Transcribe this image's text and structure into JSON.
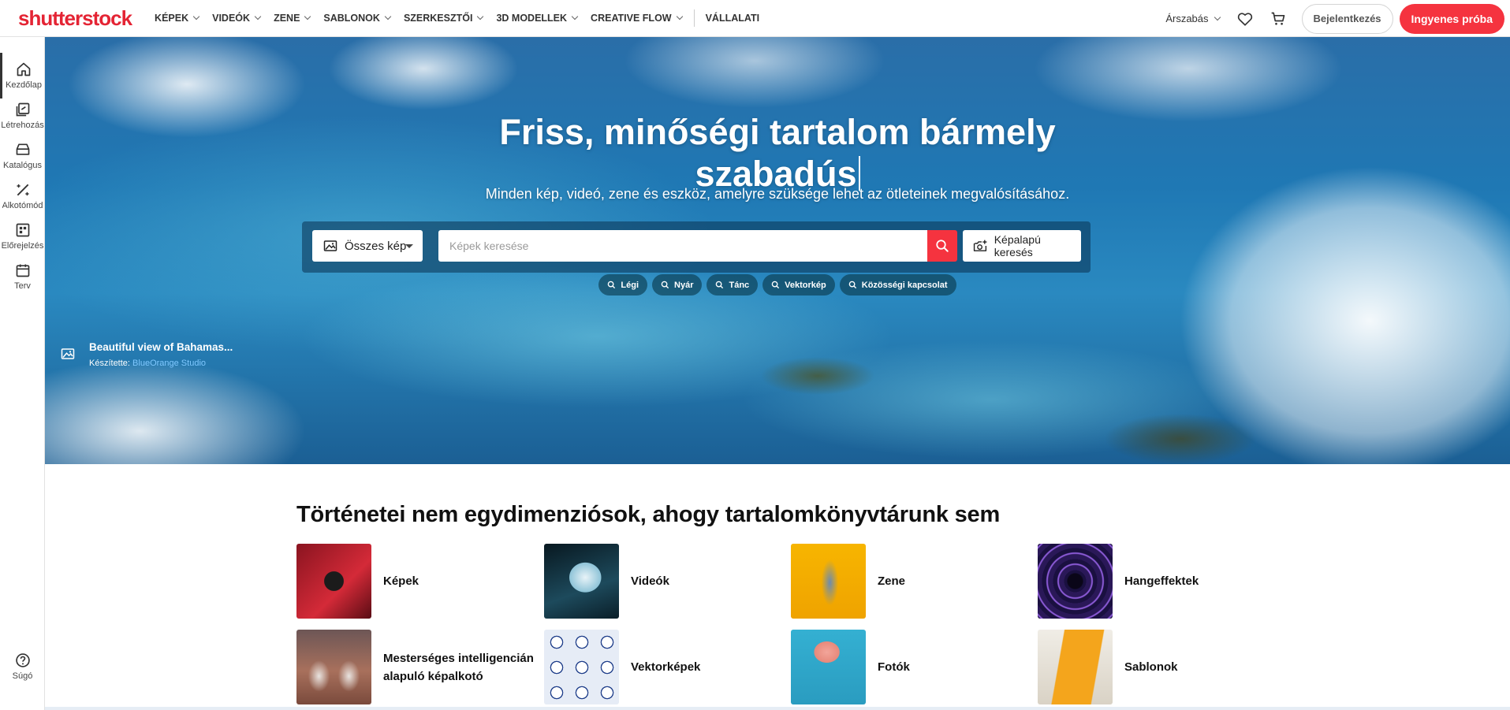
{
  "brand": {
    "logo_text": "shutterstock",
    "accent": "#f5333f"
  },
  "nav": {
    "items": [
      {
        "label": "KÉPEK",
        "dropdown": true
      },
      {
        "label": "VIDEÓK",
        "dropdown": true
      },
      {
        "label": "ZENE",
        "dropdown": true
      },
      {
        "label": "SABLONOK",
        "dropdown": true
      },
      {
        "label": "SZERKESZTŐI",
        "dropdown": true
      },
      {
        "label": "3D MODELLEK",
        "dropdown": true
      },
      {
        "label": "CREATIVE FLOW",
        "dropdown": true
      }
    ],
    "enterprise": "VÁLLALATI",
    "pricing": "Árszabás",
    "login": "Bejelentkezés",
    "trial": "Ingyenes próba"
  },
  "sidebar": {
    "items": [
      {
        "label": "Kezdőlap",
        "icon": "home-icon",
        "active": true
      },
      {
        "label": "Létrehozás",
        "icon": "create-icon"
      },
      {
        "label": "Katalógus",
        "icon": "catalog-icon"
      },
      {
        "label": "Alkotómód",
        "icon": "edit-icon"
      },
      {
        "label": "Előrejelzés",
        "icon": "forecast-icon"
      },
      {
        "label": "Terv",
        "icon": "calendar-icon"
      }
    ],
    "help": "Súgó"
  },
  "hero": {
    "title_line1": "Friss, minőségi tartalom bármely",
    "title_line2": "szabadús",
    "subtitle": "Minden kép, videó, zene és eszköz, amelyre szüksége lehet az ötleteinek megvalósításához.",
    "search": {
      "type_label": "Összes kép",
      "placeholder": "Képek keresése",
      "image_search_label": "Képalapú keresés"
    },
    "chips": [
      "Légi",
      "Nyár",
      "Tánc",
      "Vektorkép",
      "Közösségi kapcsolat"
    ],
    "credit": {
      "title": "Beautiful view of Bahamas...",
      "by_label": "Készítette:",
      "author": "BlueOrange Studio"
    }
  },
  "library": {
    "title": "Történetei nem egydimenziósok, ahogy tartalomkönyvtárunk sem",
    "categories": [
      {
        "label": "Képek",
        "colors": [
          "#7a1420",
          "#c41f2f"
        ]
      },
      {
        "label": "Videók",
        "colors": [
          "#0d1f2b",
          "#3a6f86"
        ]
      },
      {
        "label": "Zene",
        "colors": [
          "#f0a800",
          "#f6c23a"
        ]
      },
      {
        "label": "Hangeffektek",
        "colors": [
          "#1a1040",
          "#6a3fb5"
        ]
      },
      {
        "label": "Mesterséges intelligencián alapuló képalkotó",
        "colors": [
          "#6b4a4a",
          "#b07a66"
        ]
      },
      {
        "label": "Vektorképek",
        "colors": [
          "#1f3e8a",
          "#ffffff"
        ]
      },
      {
        "label": "Fotók",
        "colors": [
          "#2aa6c8",
          "#4cc3e0"
        ]
      },
      {
        "label": "Sablonok",
        "colors": [
          "#f2a33a",
          "#e9e6df"
        ]
      }
    ]
  }
}
